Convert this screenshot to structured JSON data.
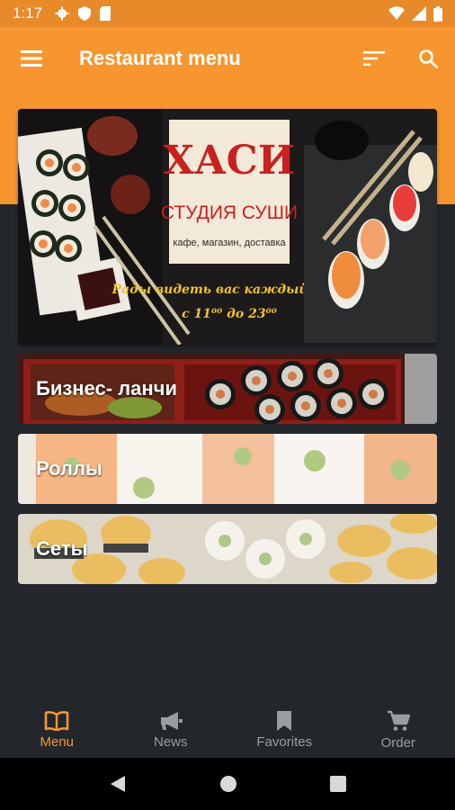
{
  "status_bar": {
    "time": "1:17"
  },
  "app_bar": {
    "title": "Restaurant menu"
  },
  "banner": {
    "brand": "ХАСИ",
    "subtitle": "СТУДИЯ СУШИ",
    "tagline": "кафе, магазин, доставка",
    "slogan_line1": "Рады видеть вас каждый день",
    "slogan_line2": "с 11⁰⁰ до 23⁰⁰"
  },
  "categories": [
    {
      "label": "Бизнес- ланчи"
    },
    {
      "label": "Роллы"
    },
    {
      "label": "Сеты"
    }
  ],
  "bottom_nav": {
    "items": [
      {
        "label": "Menu",
        "icon": "book-icon",
        "active": true
      },
      {
        "label": "News",
        "icon": "megaphone-icon",
        "active": false
      },
      {
        "label": "Favorites",
        "icon": "bookmark-icon",
        "active": false
      },
      {
        "label": "Order",
        "icon": "cart-icon",
        "active": false
      }
    ]
  },
  "colors": {
    "primary": "#f7962e",
    "background": "#23272b",
    "inactive": "#9a9da0"
  }
}
